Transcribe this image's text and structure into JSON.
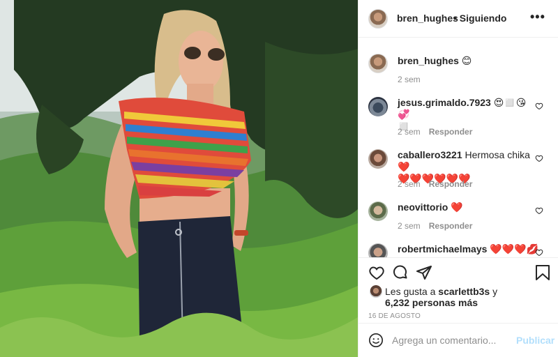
{
  "post": {
    "username": "bren_hughes",
    "follow_status": "• Siguiendo",
    "more_glyph": "•••"
  },
  "caption": {
    "username": "bren_hughes",
    "text": " 😊",
    "time": "2 sem"
  },
  "comments": [
    {
      "username": "jesus.grimaldo.7923",
      "text": " 😍◻️😘💞",
      "text2": "◻️",
      "time": "2 sem",
      "reply": "Responder"
    },
    {
      "username": "caballero3221",
      "text": " Hermosa chika❤️",
      "text2": "❤️❤️❤️❤️❤️❤️",
      "time": "2 sem",
      "reply": "Responder"
    },
    {
      "username": "neovittorio",
      "text": " ❤️",
      "time": "2 sem",
      "reply": "Responder"
    },
    {
      "username": "robertmichaelmays",
      "text": " ❤️❤️❤️💋"
    }
  ],
  "likes": {
    "line1_prefix": "Les gusta a ",
    "line1_user": "scarlettb3s",
    "line1_suffix": " y",
    "line2": "6,232 personas más"
  },
  "date": "16 DE AGOSTO",
  "composer": {
    "placeholder": "Agrega un comentario...",
    "publish": "Publicar"
  },
  "colors": {
    "text": "#262626",
    "muted": "#8e8e8e",
    "publish_disabled": "#b2dffc",
    "border": "#efefef"
  },
  "icons": [
    "heart-icon",
    "comment-icon",
    "share-icon",
    "bookmark-icon",
    "emoji-icon",
    "more-icon"
  ]
}
